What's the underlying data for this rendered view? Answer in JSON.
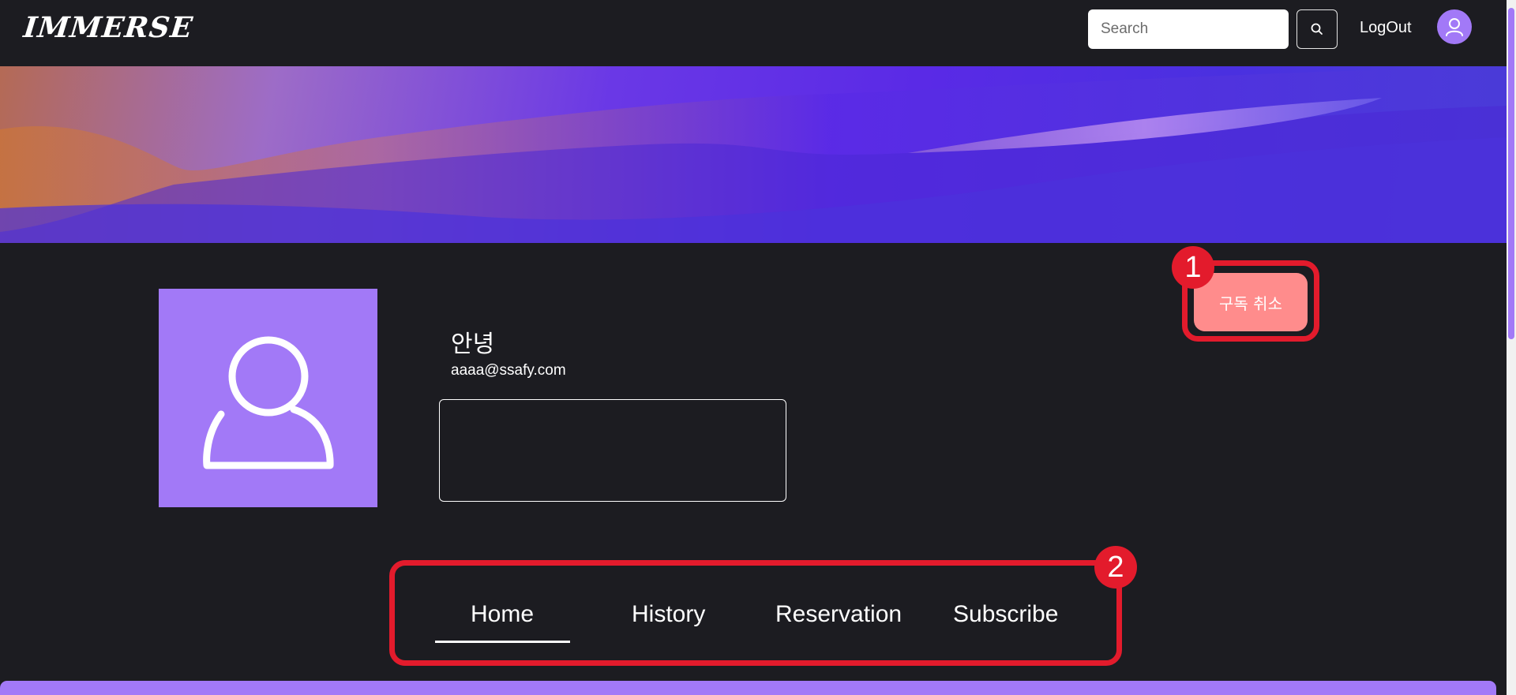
{
  "nav": {
    "logo": "IMMERSE",
    "search_placeholder": "Search",
    "logout": "LogOut",
    "icons": {
      "search": "search-icon",
      "avatar": "user-icon"
    }
  },
  "profile": {
    "name": "안녕",
    "email": "aaaa@ssafy.com",
    "bio": "",
    "picture_icon": "user-icon"
  },
  "actions": {
    "unsubscribe": "구독 취소"
  },
  "tabs": [
    {
      "label": "Home",
      "active": true
    },
    {
      "label": "History",
      "active": false
    },
    {
      "label": "Reservation",
      "active": false
    },
    {
      "label": "Subscribe",
      "active": false
    }
  ],
  "annotations": {
    "marker_1": "1",
    "marker_2": "2"
  },
  "colors": {
    "background": "#1c1c21",
    "accent_purple": "#a279f7",
    "unsubscribe_button": "#ff8c8c",
    "annotation_red": "#e31b2c"
  }
}
